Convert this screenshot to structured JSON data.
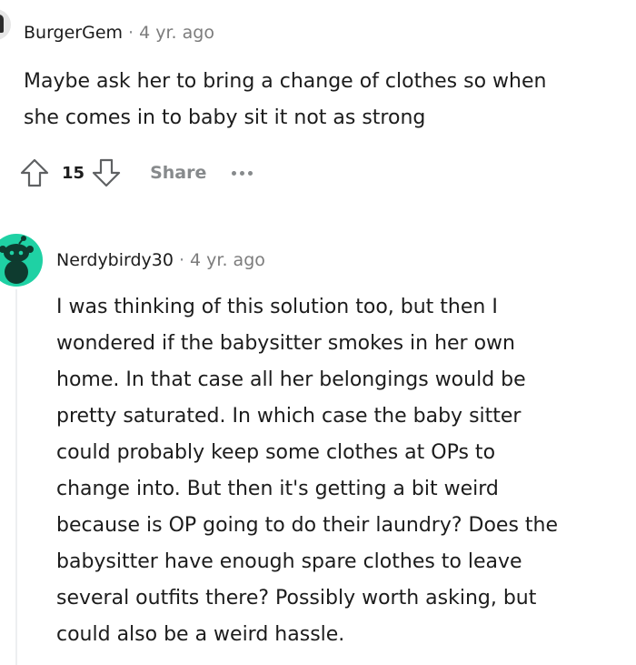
{
  "comment1": {
    "author": "BurgerGem",
    "separator": "·",
    "time": "4 yr. ago",
    "body_lines": [
      "Maybe ask her to bring a change of clothes so when",
      "she comes in to baby sit it not as strong"
    ],
    "vote_count": "15",
    "share_label": "Share"
  },
  "comment2": {
    "author": "Nerdybirdy30",
    "separator": "·",
    "time": "4 yr. ago",
    "body_lines": [
      "I was thinking of this solution too, but then I",
      "wondered if the babysitter smokes in her own",
      "home. In that case all her belongings would be",
      "pretty saturated. In which case the baby sitter",
      "could probably keep some clothes at OPs to",
      "change into. But then it's getting a bit weird",
      "because is OP going to do their laundry? Does the",
      "babysitter have enough spare clothes to leave",
      "several outfits there? Possibly worth asking, but",
      "could also be a weird hassle."
    ]
  },
  "icons": {
    "upvote": "upvote-arrow-icon",
    "downvote": "downvote-arrow-icon",
    "more": "ellipsis-icon",
    "avatar": "snoo-avatar-icon"
  },
  "colors": {
    "avatar2_bg": "#1fd1a4",
    "muted": "#878a8c",
    "text": "#1c1c1c"
  }
}
